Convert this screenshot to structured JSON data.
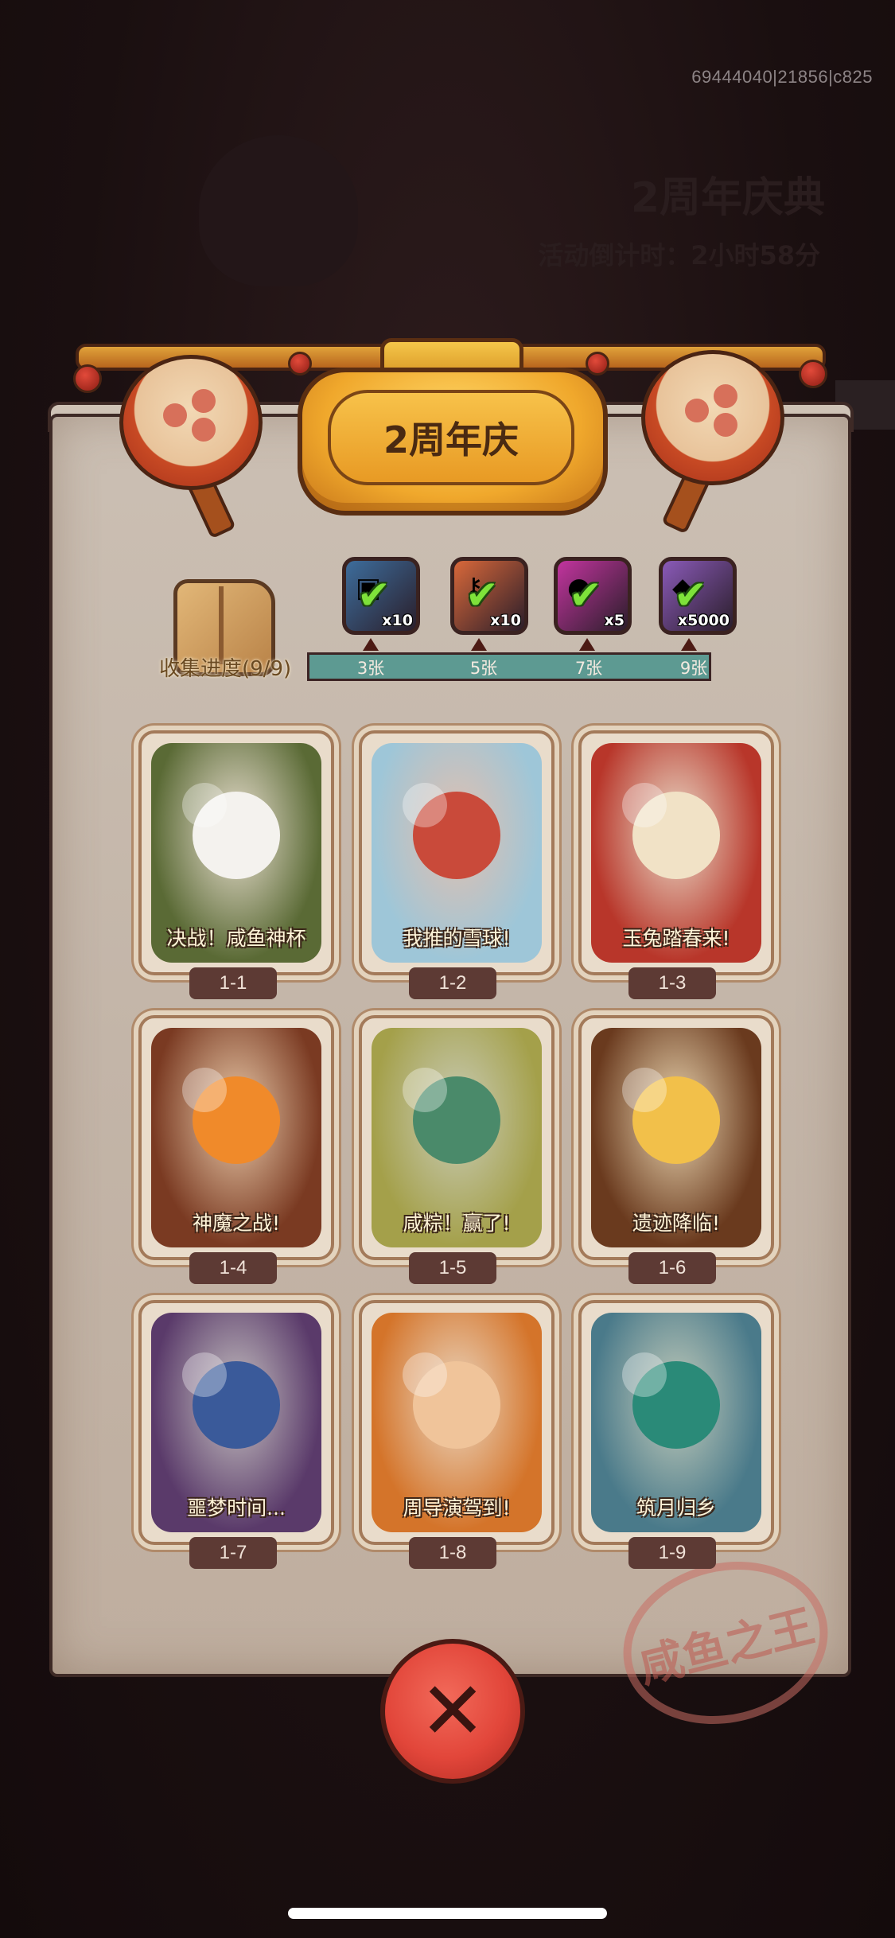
{
  "status": {
    "build_id": "69444040|21856|c825"
  },
  "background": {
    "event_title": "2周年庆典",
    "countdown": "活动倒计时：2小时58分"
  },
  "header": {
    "title": "2周年庆"
  },
  "progress": {
    "label": "收集进度(9/9)",
    "collected": 9,
    "total": 9,
    "milestones": [
      {
        "label": "3张",
        "reward_icon": "chest-icon",
        "count": "x10",
        "claimed": true,
        "color": "#3d6d9c"
      },
      {
        "label": "5张",
        "reward_icon": "scroll-key-icon",
        "count": "x10",
        "claimed": true,
        "color": "#d9683a"
      },
      {
        "label": "7张",
        "reward_icon": "gem-orb-icon",
        "count": "x5",
        "claimed": true,
        "color": "#c2349e"
      },
      {
        "label": "9张",
        "reward_icon": "iron-ingot-icon",
        "count": "x5000",
        "claimed": true,
        "color": "#8a5ab8"
      }
    ]
  },
  "cards": [
    {
      "id": "1-1",
      "caption": "决战！咸鱼神杯",
      "bg": "#5a6a35",
      "accent": "#f4f2ee"
    },
    {
      "id": "1-2",
      "caption": "我推的雪球!",
      "bg": "#9ec6d8",
      "accent": "#c94a3a"
    },
    {
      "id": "1-3",
      "caption": "玉兔踏春来!",
      "bg": "#b8362a",
      "accent": "#f1e2c6"
    },
    {
      "id": "1-4",
      "caption": "神魔之战!",
      "bg": "#7a3a22",
      "accent": "#f08a2a"
    },
    {
      "id": "1-5",
      "caption": "咸粽！赢了!",
      "bg": "#a4a04a",
      "accent": "#4a8a6a"
    },
    {
      "id": "1-6",
      "caption": "遗迹降临!",
      "bg": "#6a3a1e",
      "accent": "#f2c04a"
    },
    {
      "id": "1-7",
      "caption": "噩梦时间...",
      "bg": "#5a3a6a",
      "accent": "#3a5a9a"
    },
    {
      "id": "1-8",
      "caption": "周导演驾到!",
      "bg": "#d4742a",
      "accent": "#f0c49a"
    },
    {
      "id": "1-9",
      "caption": "筑月归乡",
      "bg": "#4a7a8a",
      "accent": "#2a8a78"
    }
  ],
  "stamp": {
    "text": "咸鱼之王"
  },
  "close_button": {
    "icon": "close-icon",
    "glyph": "✕"
  }
}
